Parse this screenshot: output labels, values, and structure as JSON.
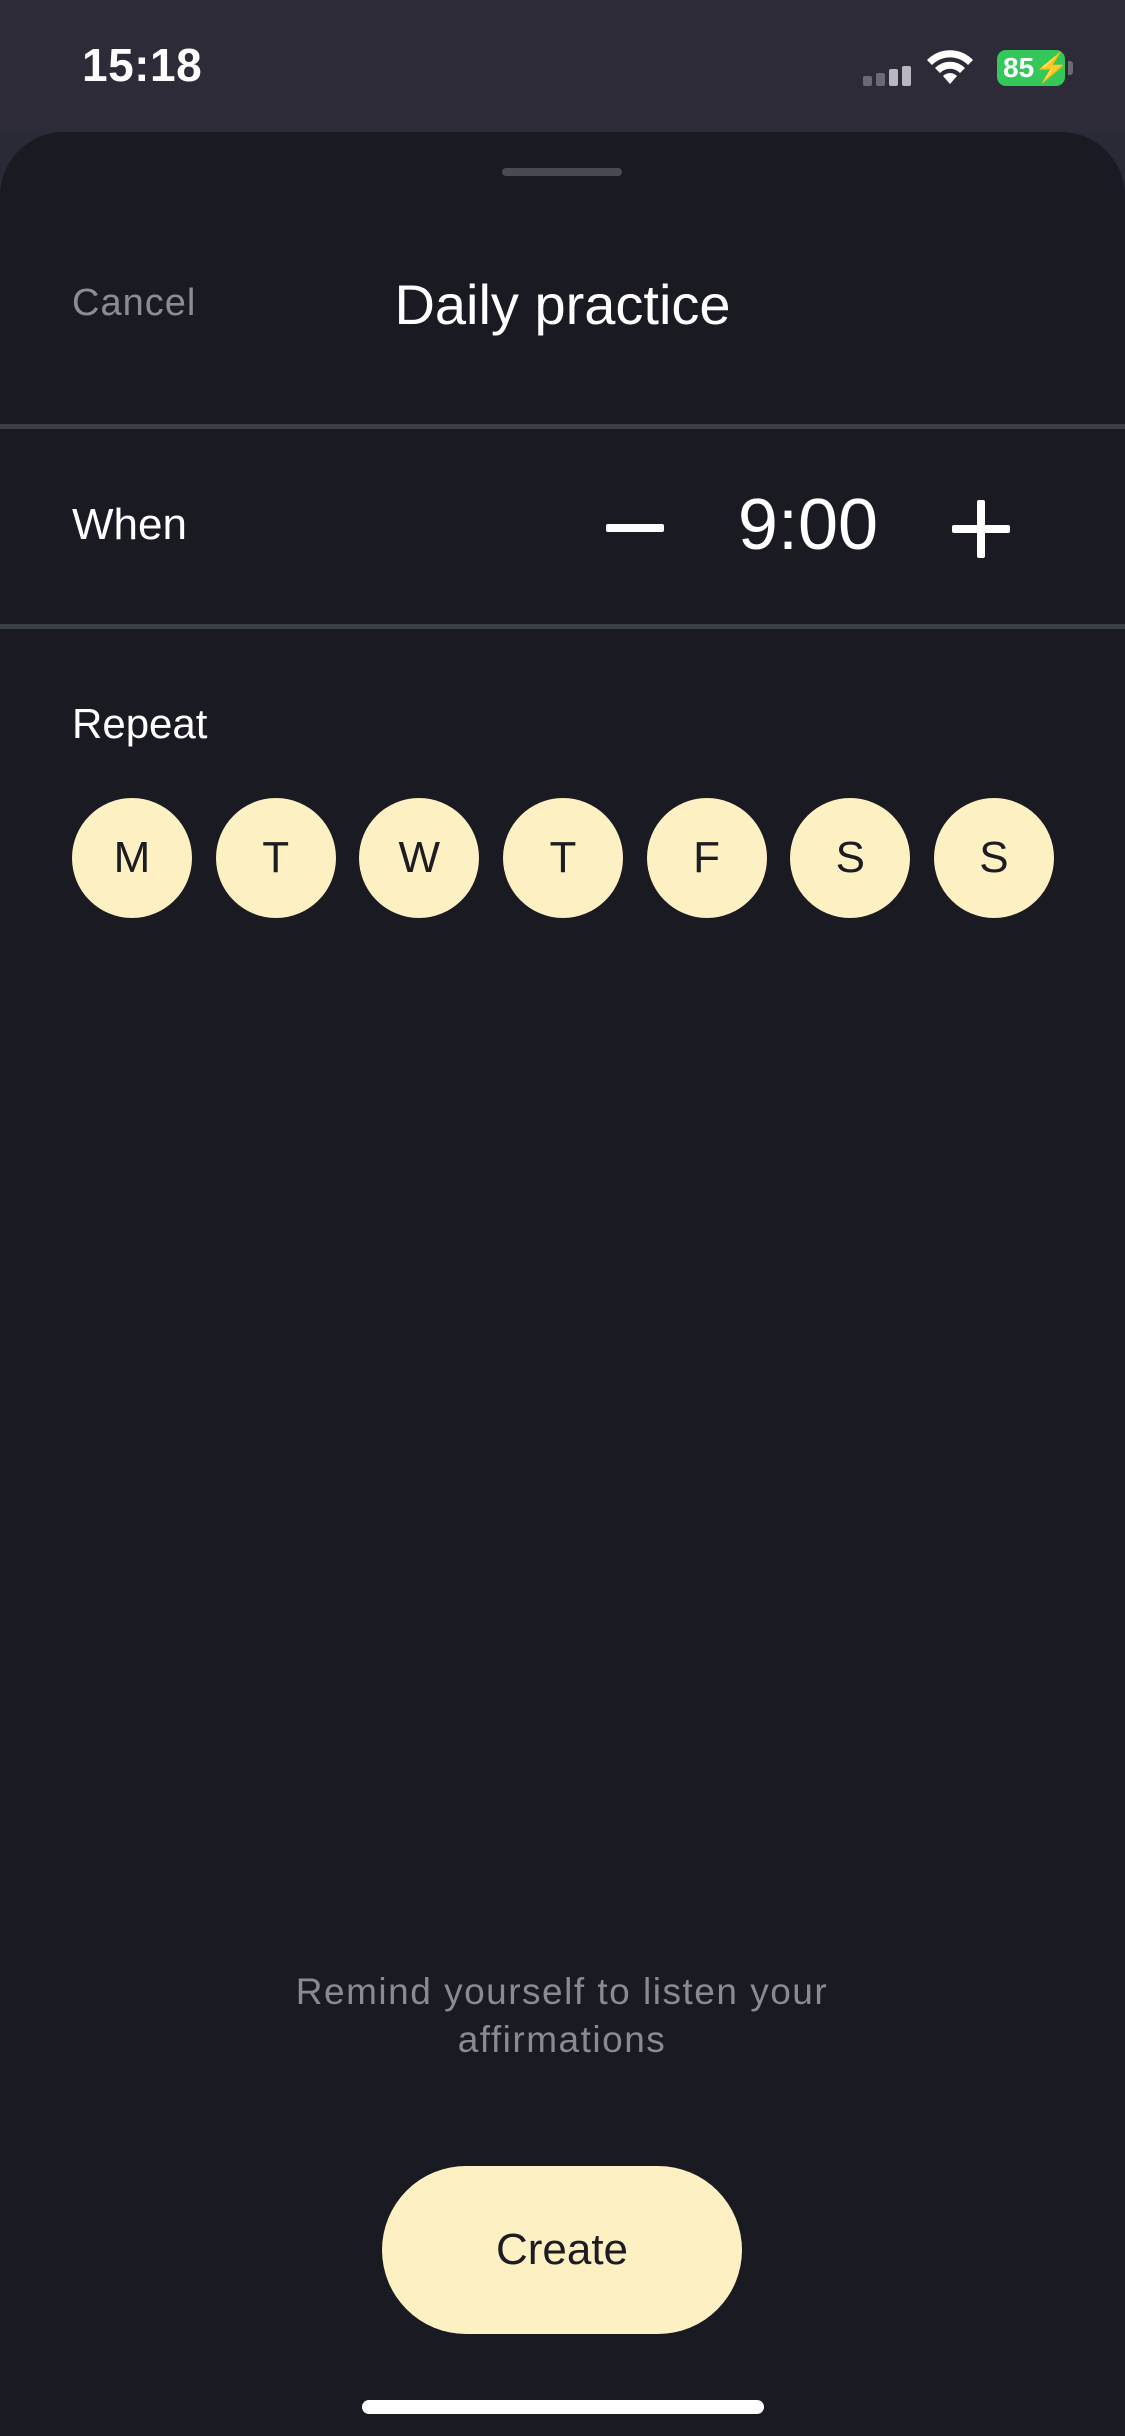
{
  "status_bar": {
    "time": "15:18",
    "battery": "85",
    "icons": [
      "signal-icon",
      "wifi-icon",
      "battery-charging-icon"
    ],
    "battery_color": "#34c759"
  },
  "header": {
    "cancel_label": "Cancel",
    "title": "Daily practice"
  },
  "when": {
    "label": "When",
    "time": "9:00",
    "decrement_icon": "minus-icon",
    "increment_icon": "plus-icon"
  },
  "repeat": {
    "label": "Repeat",
    "days": [
      {
        "label": "M",
        "selected": true
      },
      {
        "label": "T",
        "selected": true
      },
      {
        "label": "W",
        "selected": true
      },
      {
        "label": "T",
        "selected": true
      },
      {
        "label": "F",
        "selected": true
      },
      {
        "label": "S",
        "selected": true
      },
      {
        "label": "S",
        "selected": true
      }
    ]
  },
  "footer": {
    "hint": "Remind yourself to listen your affirmations",
    "create_label": "Create"
  },
  "colors": {
    "accent": "#fdf0c2",
    "background": "#1a1a22",
    "text": "#ffffff",
    "muted": "#8a8a93"
  }
}
